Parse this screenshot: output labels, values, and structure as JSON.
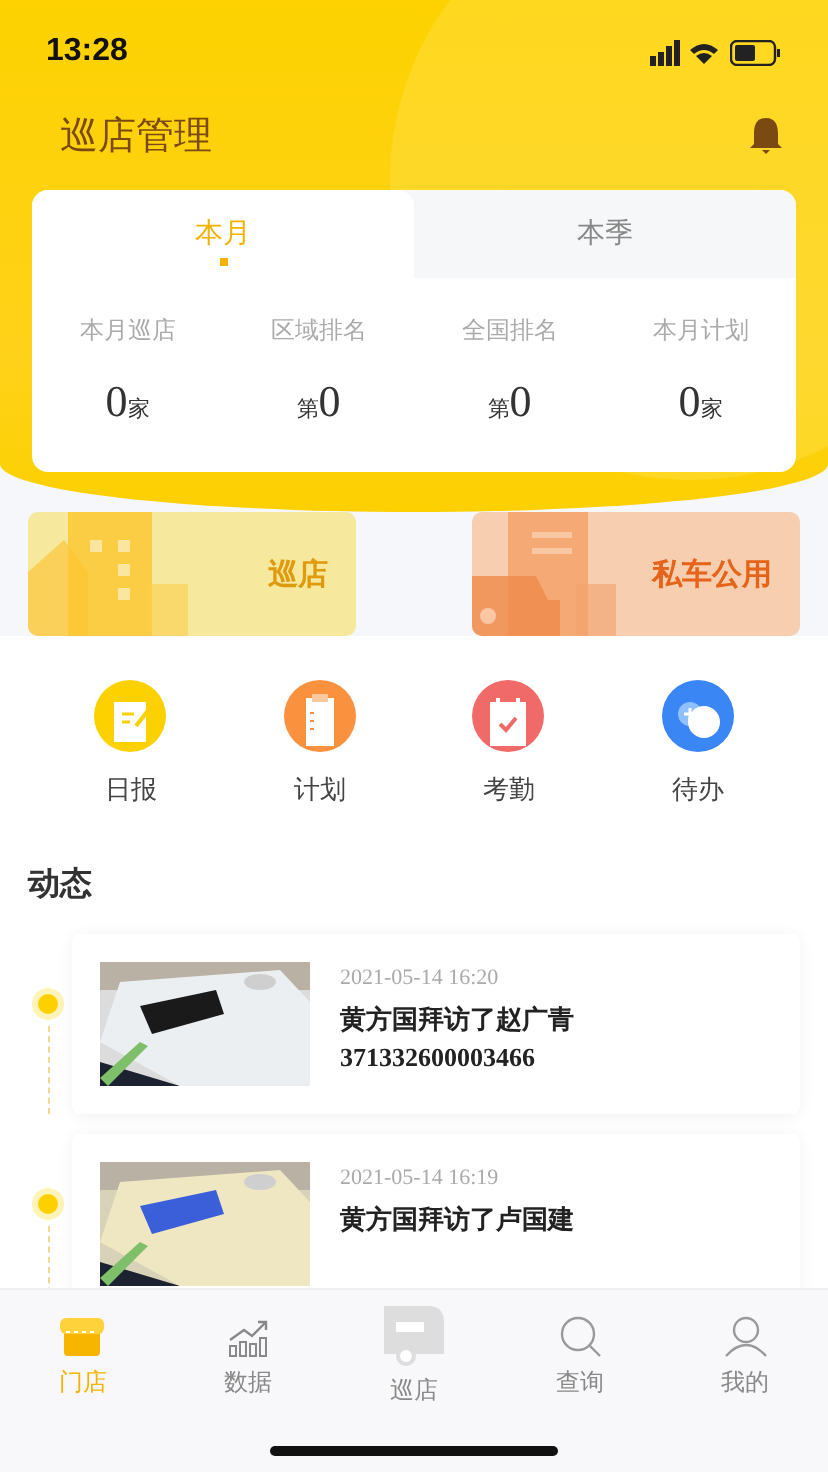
{
  "status_bar": {
    "time": "13:28"
  },
  "header": {
    "title": "巡店管理"
  },
  "stats_card": {
    "tabs": [
      {
        "label": "本月",
        "selected": true
      },
      {
        "label": "本季",
        "selected": false
      }
    ],
    "stats": [
      {
        "label": "本月巡店",
        "value": "0",
        "suffix": "家"
      },
      {
        "label": "区域排名",
        "prefix": "第",
        "value": "0"
      },
      {
        "label": "全国排名",
        "prefix": "第",
        "value": "0"
      },
      {
        "label": "本月计划",
        "value": "0",
        "suffix": "家"
      }
    ]
  },
  "banners": [
    {
      "kind": "store",
      "label": "巡店"
    },
    {
      "kind": "car",
      "label": "私车公用"
    }
  ],
  "shortcuts": [
    {
      "kind": "report",
      "label": "日报",
      "color": "#fdd000"
    },
    {
      "kind": "plan",
      "label": "计划",
      "color": "#f9913e"
    },
    {
      "kind": "attendance",
      "label": "考勤",
      "color": "#f06a6a"
    },
    {
      "kind": "todo",
      "label": "待办",
      "color": "#3b86f5"
    }
  ],
  "feed": {
    "title": "动态",
    "items": [
      {
        "time": "2021-05-14 16:20",
        "text": "黄方国拜访了赵广青",
        "code": "371332600003466"
      },
      {
        "time": "2021-05-14 16:19",
        "text": "黄方国拜访了卢国建"
      }
    ]
  },
  "tab_bar": [
    {
      "kind": "store",
      "label": "门店",
      "selected": true
    },
    {
      "kind": "data",
      "label": "数据",
      "selected": false
    },
    {
      "kind": "patrol",
      "label": "巡店",
      "selected": false
    },
    {
      "kind": "search",
      "label": "查询",
      "selected": false
    },
    {
      "kind": "user",
      "label": "我的",
      "selected": false
    }
  ]
}
